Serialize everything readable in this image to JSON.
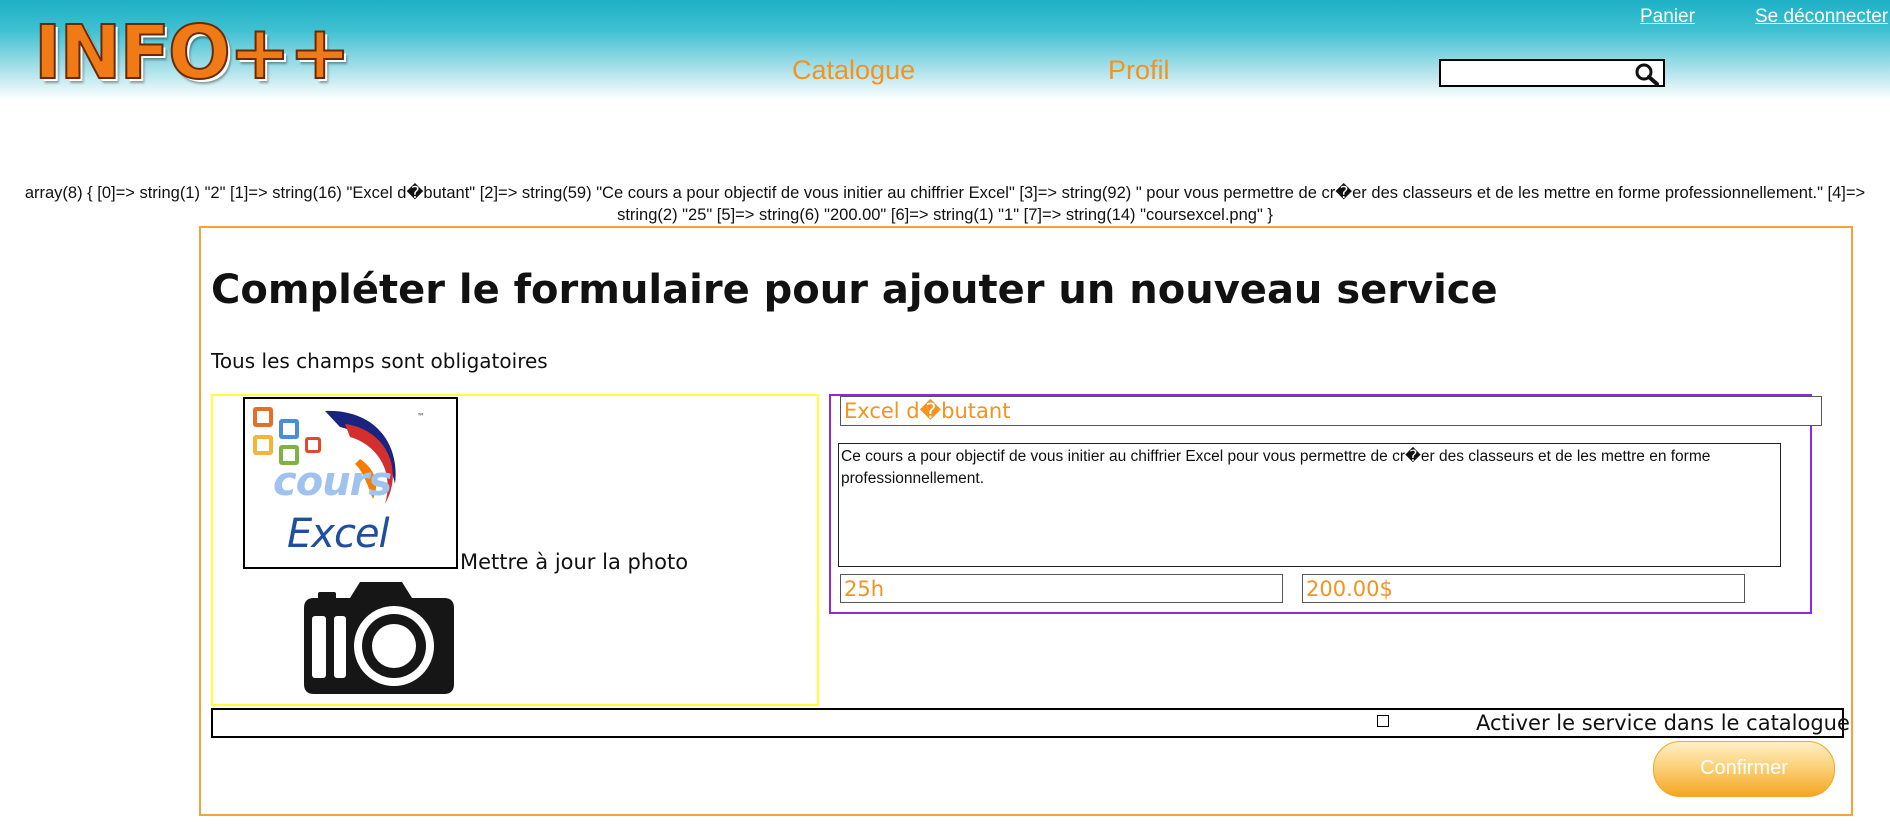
{
  "header": {
    "logo_text": "INFO++",
    "top_links": {
      "cart": "Panier",
      "logout": "Se déconnecter"
    },
    "nav": {
      "catalogue": "Catalogue",
      "profile": "Profil"
    },
    "search": {
      "value": "",
      "icon": "search-icon"
    }
  },
  "debug_dump": "array(8) { [0]=> string(1) \"2\" [1]=> string(16) \"Excel d�butant\" [2]=> string(59) \"Ce cours a pour objectif de vous initier au chiffrier Excel\" [3]=> string(92) \" pour vous permettre de cr�er des classeurs et de les mettre en forme professionnellement.\" [4]=> string(2) \"25\" [5]=> string(6) \"200.00\" [6]=> string(1) \"1\" [7]=> string(14) \"coursexcel.png\" }",
  "form": {
    "title": "Compléter le formulaire pour ajouter un nouveau service",
    "subtitle": "Tous les champs sont obligatoires",
    "photo": {
      "image_text_top": "cours",
      "image_text_bottom": "Excel",
      "update_label": "Mettre à jour la photo",
      "camera_icon": "camera-icon"
    },
    "fields": {
      "name": "Excel d�butant",
      "description": "Ce cours a pour objectif de vous initier au chiffrier Excel pour vous permettre de cr�er des classeurs et de les mettre en forme professionnellement.",
      "duration": "25h",
      "price": "200.00$"
    },
    "activate_label": "Activer le service dans le catalogue",
    "activate_checked": false,
    "confirm_label": "Confirmer"
  },
  "colors": {
    "accent_orange": "#f39320",
    "header_teal": "#1eb0c6",
    "frame_orange": "#f6a23a",
    "photo_border": "#ffff33",
    "fields_border": "#8a2be2"
  }
}
